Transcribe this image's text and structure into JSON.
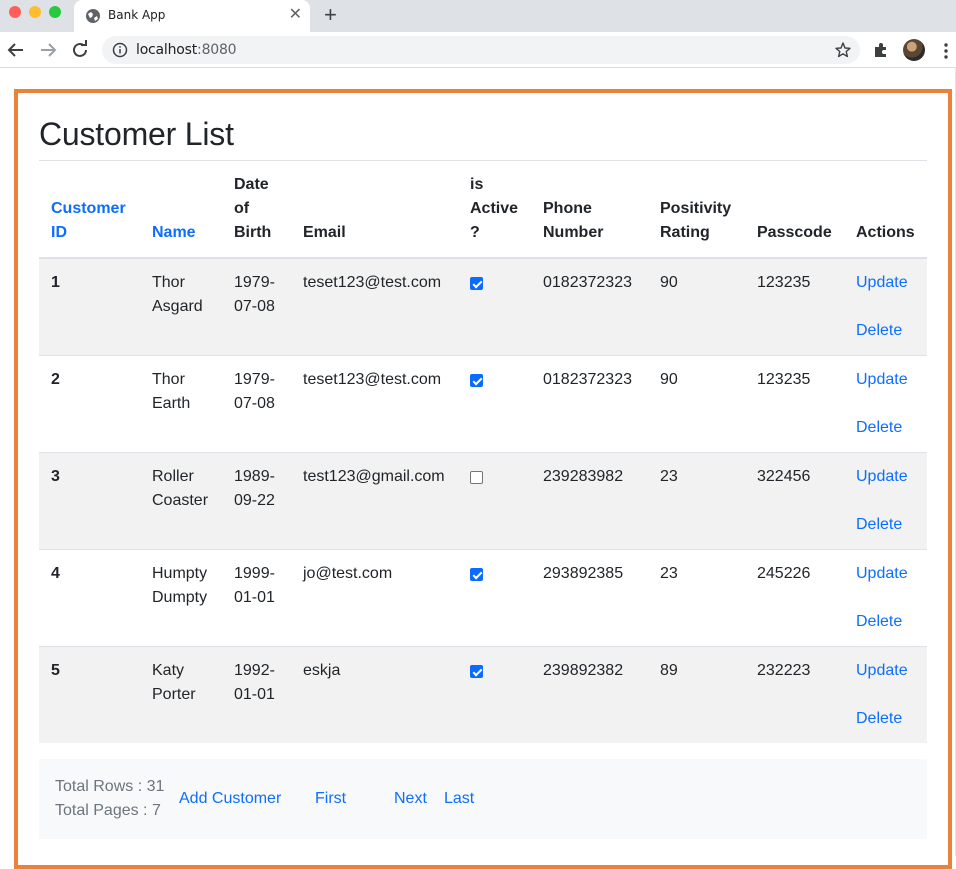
{
  "browser": {
    "tab_title": "Bank App",
    "url_host": "localhost",
    "url_port": ":8080"
  },
  "page": {
    "title": "Customer List"
  },
  "table": {
    "headers": {
      "customer_id": "Customer ID",
      "name": "Name",
      "dob": "Date of Birth",
      "email": "Email",
      "is_active": "is Active ?",
      "phone": "Phone Number",
      "rating": "Positivity Rating",
      "passcode": "Passcode",
      "actions": "Actions"
    },
    "rows": [
      {
        "id": "1",
        "name": "Thor Asgard",
        "dob": "1979-07-08",
        "email": "teset123@test.com",
        "active": true,
        "phone": "0182372323",
        "rating": "90",
        "passcode": "123235"
      },
      {
        "id": "2",
        "name": "Thor Earth",
        "dob": "1979-07-08",
        "email": "teset123@test.com",
        "active": true,
        "phone": "0182372323",
        "rating": "90",
        "passcode": "123235"
      },
      {
        "id": "3",
        "name": "Roller Coaster",
        "dob": "1989-09-22",
        "email": "test123@gmail.com",
        "active": false,
        "phone": "239283982",
        "rating": "23",
        "passcode": "322456"
      },
      {
        "id": "4",
        "name": "Humpty Dumpty",
        "dob": "1999-01-01",
        "email": "jo@test.com",
        "active": true,
        "phone": "293892385",
        "rating": "23",
        "passcode": "245226"
      },
      {
        "id": "5",
        "name": "Katy Porter",
        "dob": "1992-01-01",
        "email": "eskja",
        "active": true,
        "phone": "239892382",
        "rating": "89",
        "passcode": "232223"
      }
    ],
    "actions": {
      "update": "Update",
      "delete": "Delete"
    }
  },
  "footer": {
    "total_rows": "Total Rows : 31",
    "total_pages": "Total Pages : 7",
    "add_customer": "Add Customer",
    "first": "First",
    "next": "Next",
    "last": "Last"
  },
  "colors": {
    "frame_border": "#e9833a",
    "link": "#0d6efd",
    "checkbox_checked": "#0a6bff"
  }
}
